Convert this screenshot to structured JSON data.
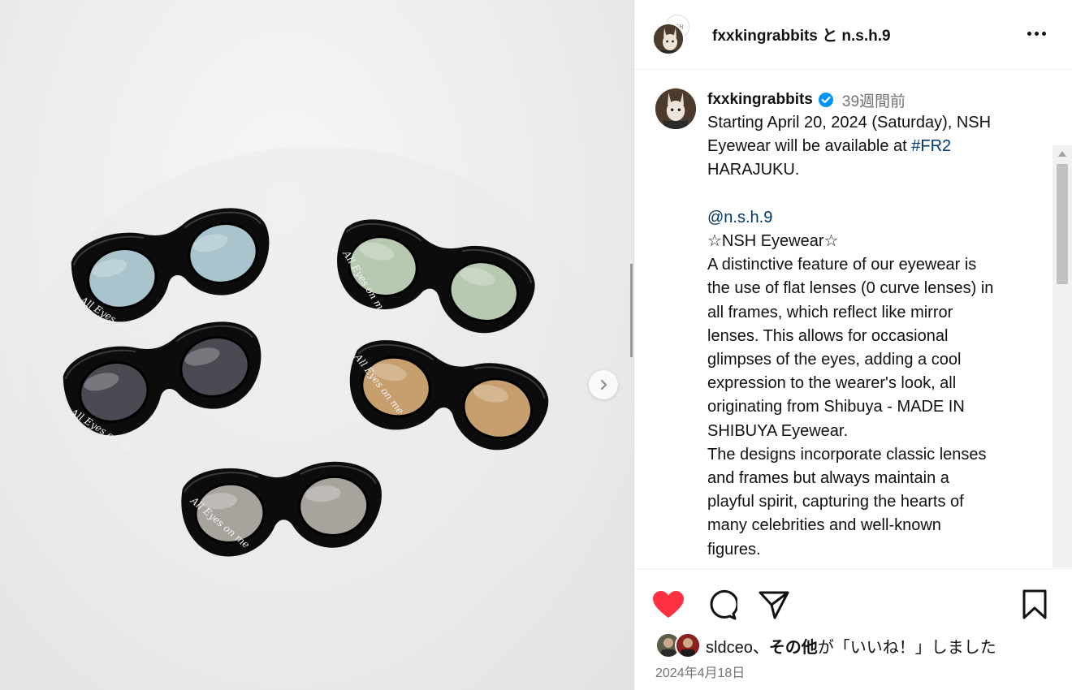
{
  "header": {
    "title": "fxxkingrabbits と n.s.h.9",
    "secondary_avatar_text": "NSH"
  },
  "post_image": {
    "frame_text": "All Eyes on me",
    "lens_colors": [
      "#a9c4cc",
      "#b7c9b0",
      "#4a4a52",
      "#c79e6e",
      "#a9a39d"
    ],
    "frame_color": "#0c0c0c"
  },
  "caption": {
    "username": "fxxkingrabbits",
    "time": "39週間前",
    "line1_a": "Starting April 20, 2024 (Saturday), NSH",
    "line2_a": "Eyewear will be available at ",
    "line2_link": "#FR2",
    "line3": "HARAJUKU.",
    "mention": "@n.s.h.9",
    "title_line": "☆NSH Eyewear☆",
    "paragraph": "A distinctive feature of our eyewear is\nthe use of flat lenses (0 curve lenses) in\nall frames, which reflect like mirror\nlenses. This allows for occasional\nglimpses of the eyes, adding a cool\nexpression to the wearer's look, all\noriginating from Shibuya - MADE IN\nSHIBUYA Eyewear.\nThe designs incorporate classic lenses\nand frames but always maintain a\nplayful spirit, capturing the hearts of\nmany celebrities and well-known\nfigures."
  },
  "actions": {
    "like_color": "#ff3040"
  },
  "likes": {
    "user": "sldceo",
    "sep": "、",
    "others": "その他",
    "suffix": "が「いいね！」しました"
  },
  "date": "2024年4月18日"
}
